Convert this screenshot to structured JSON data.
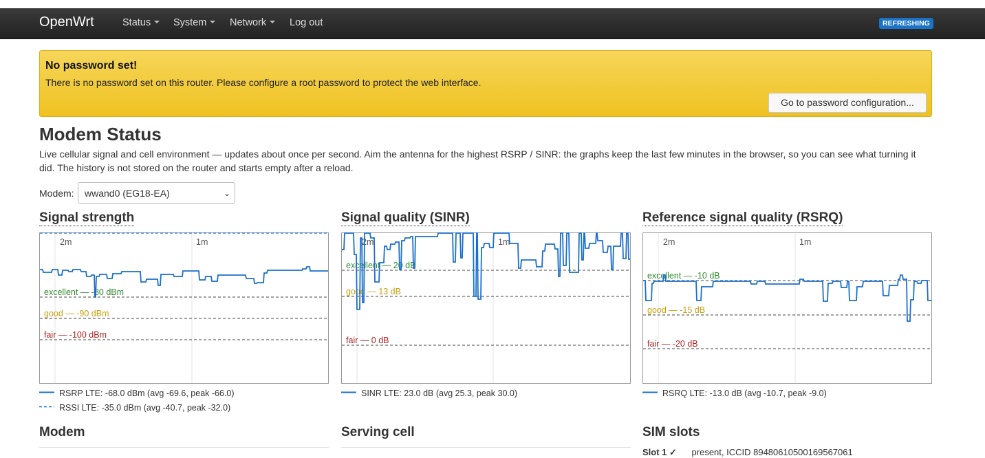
{
  "nav": {
    "brand": "OpenWrt",
    "items": [
      "Status",
      "System",
      "Network",
      "Log out"
    ],
    "badge": "REFRESHING"
  },
  "alert": {
    "title": "No password set!",
    "message": "There is no password set on this router. Please configure a root password to protect the web interface.",
    "button": "Go to password configuration..."
  },
  "page": {
    "title": "Modem Status",
    "description": "Live cellular signal and cell environment — updates about once per second. Aim the antenna for the highest RSRP / SINR: the graphs keep the last few minutes in the browser, so you can see what turning it did. The history is not stored on the router and starts empty after a reload.",
    "modem_label": "Modem:",
    "modem_selected": "wwand0 (EG18-EA)"
  },
  "colors": {
    "series": "#1a6fcc",
    "excellent": "#2e8b2e",
    "good": "#c9a010",
    "fair": "#b22222"
  },
  "charts": [
    {
      "title": "Signal strength",
      "time_labels": [
        "2m",
        "1m"
      ],
      "thresholds": [
        {
          "label": "excellent — -80 dBm",
          "level": "excellent"
        },
        {
          "label": "good — -90 dBm",
          "level": "good"
        },
        {
          "label": "fair — -100 dBm",
          "level": "fair"
        }
      ],
      "legend": [
        {
          "text": "RSRP LTE: -68.0 dBm (avg -69.6, peak -66.0)",
          "style": "solid"
        },
        {
          "text": "RSSI LTE: -35.0 dBm (avg -40.7, peak -32.0)",
          "style": "dashed"
        }
      ]
    },
    {
      "title": "Signal quality (SINR)",
      "time_labels": [
        "2m",
        "1m"
      ],
      "thresholds": [
        {
          "label": "excellent — 20 dB",
          "level": "excellent"
        },
        {
          "label": "good — 13 dB",
          "level": "good"
        },
        {
          "label": "fair — 0 dB",
          "level": "fair"
        }
      ],
      "legend": [
        {
          "text": "SINR LTE: 23.0 dB (avg 25.3, peak 30.0)",
          "style": "solid"
        }
      ]
    },
    {
      "title": "Reference signal quality (RSRQ)",
      "time_labels": [
        "2m",
        "1m"
      ],
      "thresholds": [
        {
          "label": "excellent — -10 dB",
          "level": "excellent"
        },
        {
          "label": "good — -15 dB",
          "level": "good"
        },
        {
          "label": "fair — -20 dB",
          "level": "fair"
        }
      ],
      "legend": [
        {
          "text": "RSRQ LTE: -13.0 dB (avg -10.7, peak -9.0)",
          "style": "solid"
        }
      ]
    }
  ],
  "sections": [
    "Modem",
    "Serving cell",
    "SIM slots"
  ],
  "sim": {
    "slot": "Slot 1 ✓",
    "status": "present, ICCID 89480610500169567061"
  }
}
